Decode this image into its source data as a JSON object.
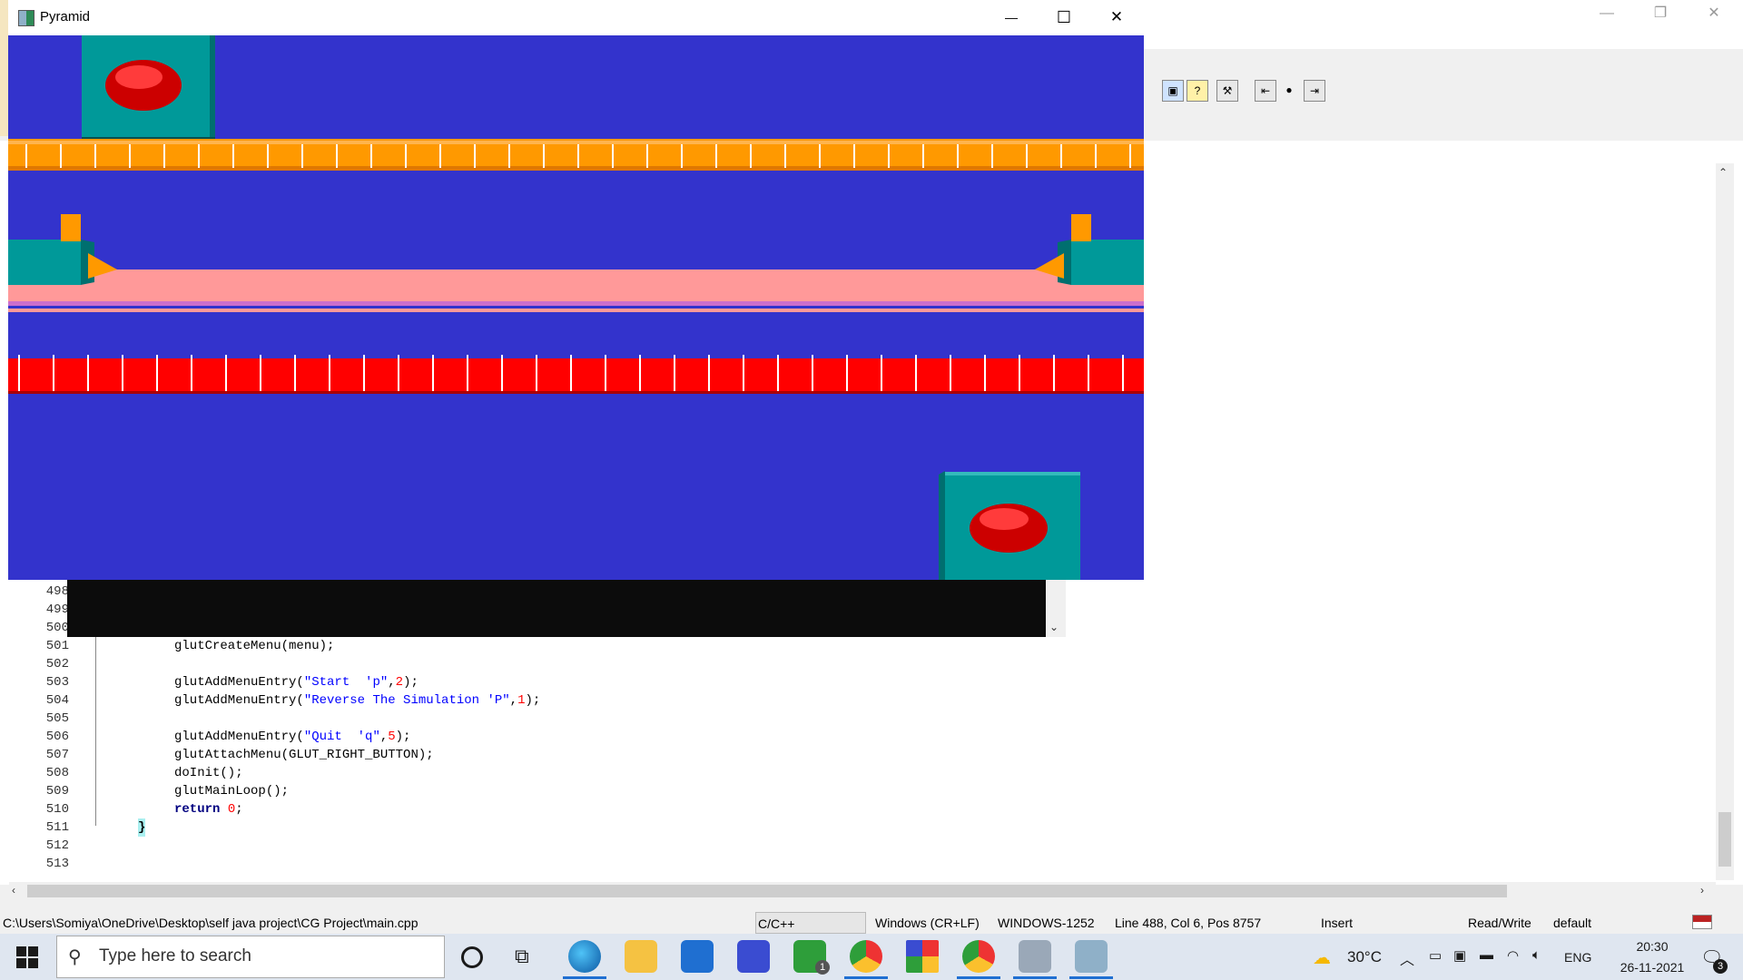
{
  "pyramid_window": {
    "title": "Pyramid",
    "minimize": "—",
    "maximize": "☐",
    "close": "✕"
  },
  "ide": {
    "window_controls": {
      "minimize": "—",
      "restore": "❐",
      "close": "✕"
    },
    "toolbar_icons": [
      "screenshot-icon",
      "help-icon",
      "wrench-icon",
      "step-back-icon",
      "record-icon",
      "step-forward-icon"
    ],
    "line_numbers": [
      "498",
      "499",
      "500",
      "501",
      "502",
      "503",
      "504",
      "505",
      "506",
      "507",
      "508",
      "509",
      "510",
      "511",
      "512",
      "513"
    ],
    "code": {
      "l501": "glutCreateMenu(menu);",
      "l503_fn": "glutAddMenuEntry(",
      "l503_str": "\"Start  'p\"",
      "l503_rest": ",",
      "l503_num": "2",
      "l503_end": ");",
      "l504_fn": "glutAddMenuEntry(",
      "l504_str": "\"Reverse The Simulation 'P\"",
      "l504_rest": ",",
      "l504_num": "1",
      "l504_end": ");",
      "l506_fn": "glutAddMenuEntry(",
      "l506_str": "\"Quit  'q\"",
      "l506_rest": ",",
      "l506_num": "5",
      "l506_end": ");",
      "l507": "glutAttachMenu(GLUT_RIGHT_BUTTON);",
      "l508": "doInit();",
      "l509": "glutMainLoop();",
      "l510_kw": "return",
      "l510_num": "0",
      "l510_end": ";",
      "l511": "}"
    }
  },
  "statusbar": {
    "path": "C:\\Users\\Somiya\\OneDrive\\Desktop\\self java project\\CG Project\\main.cpp",
    "language": "C/C++",
    "line_endings": "Windows (CR+LF)",
    "encoding": "WINDOWS-1252",
    "position": "Line 488, Col 6, Pos 8757",
    "mode": "Insert",
    "access": "Read/Write",
    "scheme": "default"
  },
  "taskbar": {
    "search_placeholder": "Type here to search",
    "weather": "30°C",
    "language": "ENG",
    "time": "20:30",
    "date": "26-11-2021",
    "notification_count": "3",
    "xbox_badge": "1"
  },
  "colors": {
    "canvas_bg": "#3333cc",
    "orange_belt": "#ff9900",
    "red_belt": "#ff0000",
    "pink_track": "#ff9999",
    "teal_box": "#009999",
    "red_disc": "#dd0000"
  }
}
